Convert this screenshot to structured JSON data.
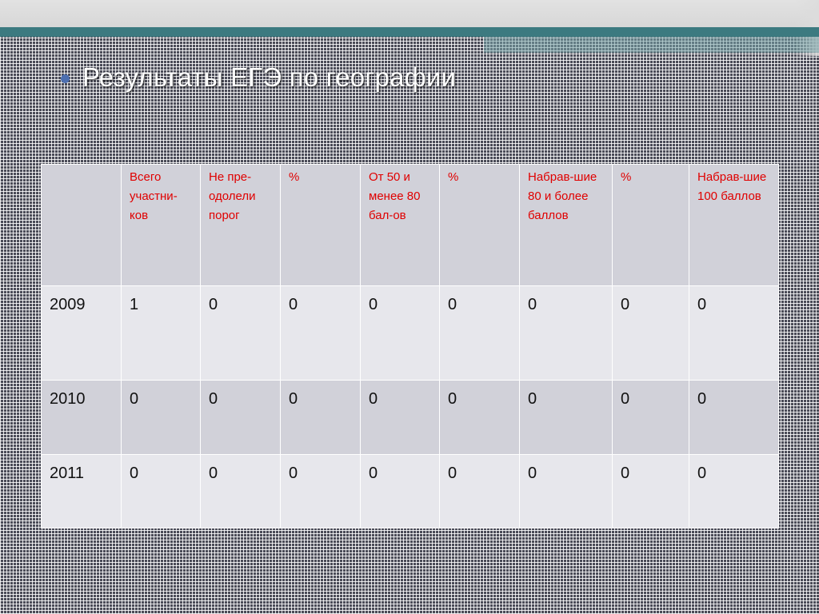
{
  "slide": {
    "title": "Результаты  ЕГЭ по географии"
  },
  "table": {
    "headers": [
      "",
      "Всего участни-ков",
      "Не пре-одолели порог",
      "%",
      "От 50 и менее 80 бал-ов",
      "%",
      "Набрав-шие 80 и более баллов",
      "%",
      "Набрав-шие 100 баллов"
    ],
    "rows": [
      [
        "2009",
        "1",
        "0",
        "0",
        "0",
        "0",
        "0",
        "0",
        "0"
      ],
      [
        "2010",
        "0",
        "0",
        "0",
        "0",
        "0",
        "0",
        "0",
        "0"
      ],
      [
        "2011",
        "0",
        "0",
        "0",
        "0",
        "0",
        "0",
        "0",
        "0"
      ]
    ]
  },
  "colors": {
    "background": "#4a4b57",
    "accent_teal": "#3c7a80",
    "bullet": "#4d6fb0",
    "header_text": "#e00000",
    "row_light": "#e7e7ec",
    "row_mid": "#d1d1d9"
  }
}
